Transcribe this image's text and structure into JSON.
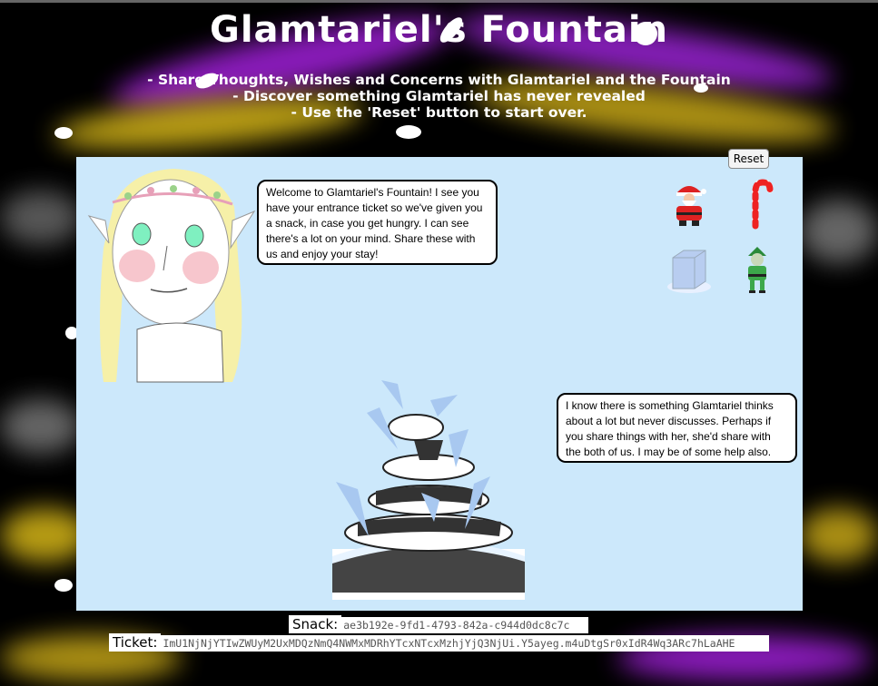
{
  "page": {
    "title": "Glamtariel's Fountain",
    "instructions": [
      "- Share Thoughts, Wishes and Concerns with Glamtariel and the Fountain",
      "- Discover something Glamtariel has never revealed",
      "- Use the 'Reset' button to start over."
    ]
  },
  "toolbar": {
    "reset_label": "Reset"
  },
  "dialog": {
    "glamtariel_message": "Welcome to Glamtariel's Fountain! I see you have your entrance ticket so we've given you a snack, in case you get hungry. I can see there's a lot on your mind. Share these with us and enjoy your stay!",
    "fountain_message": "I know there is something Glamtariel thinks about a lot but never discusses. Perhaps if you share things with her, she'd share with the both of us. I may be of some help also."
  },
  "items": [
    {
      "icon": "santa-icon"
    },
    {
      "icon": "candy-cane-icon"
    },
    {
      "icon": "ice-cube-icon"
    },
    {
      "icon": "elf-icon"
    }
  ],
  "fields": {
    "snack_label": "Snack:",
    "snack_value": "ae3b192e-9fd1-4793-842a-c944d0dc8c7c",
    "ticket_label": "Ticket:",
    "ticket_value": "ImU1NjNjYTIwZWUyM2UxMDQzNmQ4NWMxMDRhYTcxNTcxMzhjYjQ3NjUi.Y5ayeg.m4uDtgSr0xIdR4Wq3ARc7hLaAHE"
  },
  "colors": {
    "panel_background": "#cce8fb",
    "streak_purple": "#a020d8",
    "streak_yellow": "#d8b818"
  }
}
